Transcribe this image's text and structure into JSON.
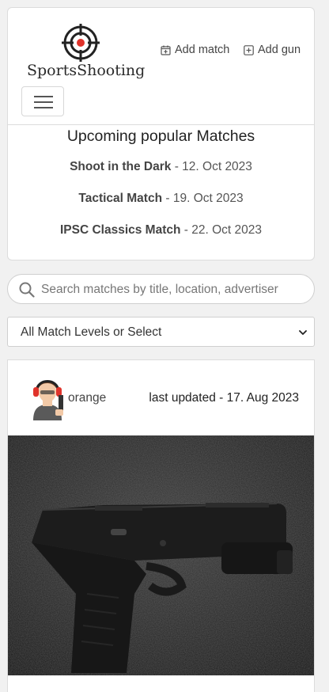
{
  "header": {
    "logo_text": "SportsShooting",
    "add_match_label": "Add match",
    "add_gun_label": "Add gun"
  },
  "upcoming": {
    "title": "Upcoming popular Matches",
    "matches": [
      {
        "title": "Shoot in the Dark",
        "date": " - 12. Oct 2023"
      },
      {
        "title": "Tactical Match",
        "date": " - 19. Oct 2023"
      },
      {
        "title": "IPSC Classics Match",
        "date": " - 22. Oct 2023"
      }
    ]
  },
  "search": {
    "placeholder": "Search matches by title, location, advertiser",
    "value": ""
  },
  "filter": {
    "selected": "All Match Levels or Select"
  },
  "match_card": {
    "username": "orange",
    "updated": "last updated - 17. Aug 2023"
  },
  "colors": {
    "accent_red": "#e0332b",
    "background": "#f1f1f1"
  }
}
